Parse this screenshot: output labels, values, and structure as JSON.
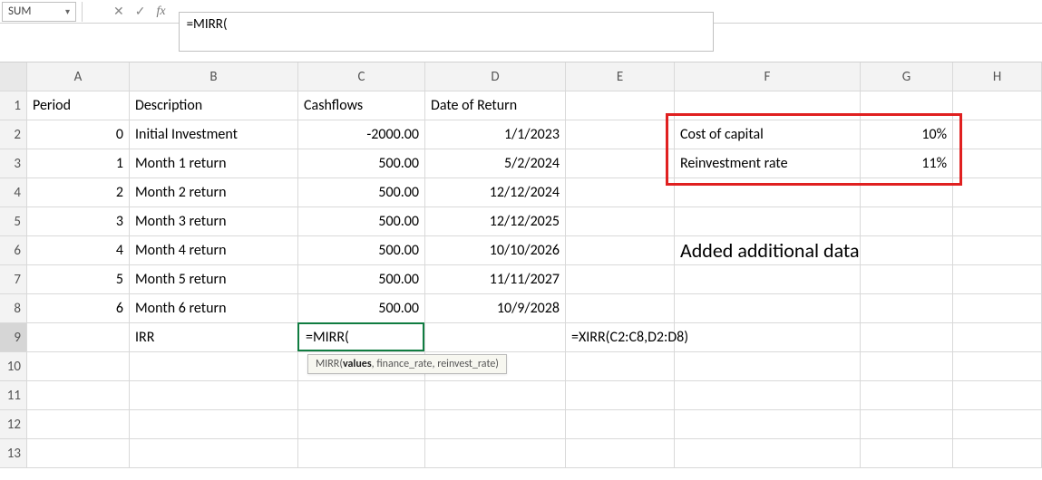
{
  "name_box": "SUM",
  "formula_bar": "=MIRR(",
  "tooltip": {
    "fn": "MIRR",
    "bold": "values",
    "rest": ", finance_rate, reinvest_rate)"
  },
  "columns": [
    "A",
    "B",
    "C",
    "D",
    "E",
    "F",
    "G",
    "H"
  ],
  "rows": [
    "1",
    "2",
    "3",
    "4",
    "5",
    "6",
    "7",
    "8",
    "9",
    "10",
    "11",
    "12",
    "13"
  ],
  "headers": {
    "A1": "Period",
    "B1": "Description",
    "C1": "Cashflows",
    "D1": "Date of Return"
  },
  "data": [
    {
      "period": "0",
      "desc": "Initial Investment",
      "cash": "-2000.00",
      "date": "1/1/2023"
    },
    {
      "period": "1",
      "desc": "Month 1 return",
      "cash": "500.00",
      "date": "5/2/2024"
    },
    {
      "period": "2",
      "desc": "Month 2 return",
      "cash": "500.00",
      "date": "12/12/2024"
    },
    {
      "period": "3",
      "desc": "Month 3 return",
      "cash": "500.00",
      "date": "12/12/2025"
    },
    {
      "period": "4",
      "desc": "Month 4 return",
      "cash": "500.00",
      "date": "10/10/2026"
    },
    {
      "period": "5",
      "desc": "Month 5 return",
      "cash": "500.00",
      "date": "11/11/2027"
    },
    {
      "period": "6",
      "desc": "Month 6 return",
      "cash": "500.00",
      "date": "10/9/2028"
    }
  ],
  "row9": {
    "B": "IRR",
    "C": "=MIRR(",
    "E": "=XIRR(C2:C8,D2:D8)"
  },
  "side": {
    "F2": "Cost of capital",
    "G2": "10%",
    "F3": "Reinvestment rate",
    "G3": "11%"
  },
  "annotation": "Added additional data"
}
